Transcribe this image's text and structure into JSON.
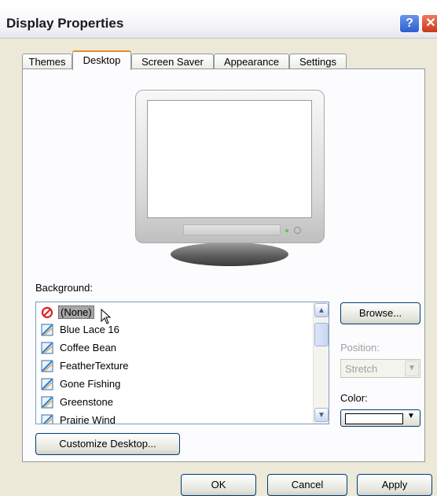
{
  "window": {
    "title": "Display Properties"
  },
  "tabs": [
    {
      "label": "Themes"
    },
    {
      "label": "Desktop",
      "active": true
    },
    {
      "label": "Screen Saver"
    },
    {
      "label": "Appearance"
    },
    {
      "label": "Settings"
    }
  ],
  "desktop": {
    "background_label": "Background:",
    "backgrounds": [
      {
        "label": "(None)",
        "icon": "none-icon",
        "selected": true
      },
      {
        "label": "Blue Lace 16",
        "icon": "image-file-icon"
      },
      {
        "label": "Coffee Bean",
        "icon": "image-file-icon"
      },
      {
        "label": "FeatherTexture",
        "icon": "image-file-icon"
      },
      {
        "label": "Gone Fishing",
        "icon": "image-file-icon"
      },
      {
        "label": "Greenstone",
        "icon": "image-file-icon"
      },
      {
        "label": "Prairie Wind",
        "icon": "image-file-icon"
      }
    ],
    "browse_label": "Browse...",
    "position_label": "Position:",
    "position_value": "Stretch",
    "color_label": "Color:",
    "color_value": "#ffffff",
    "customize_label": "Customize Desktop..."
  },
  "footer": {
    "ok_label": "OK",
    "cancel_label": "Cancel",
    "apply_label": "Apply"
  }
}
